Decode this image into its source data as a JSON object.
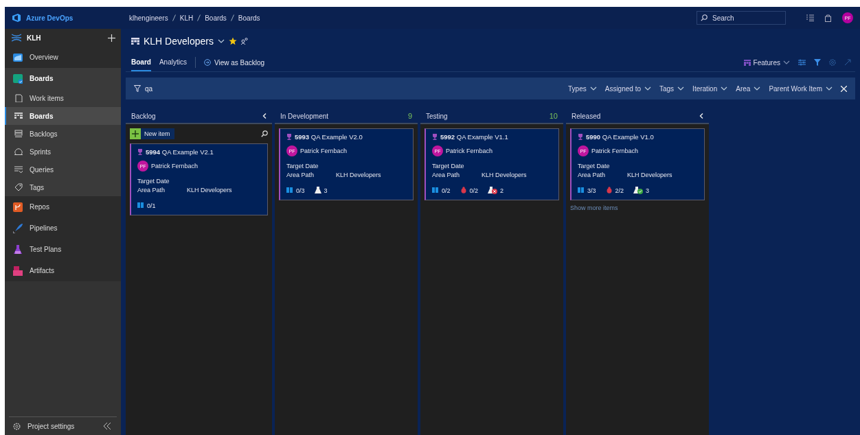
{
  "topbar": {
    "product": "Azure DevOps",
    "breadcrumb": [
      "klhengineers",
      "KLH",
      "Boards",
      "Boards"
    ],
    "search": {
      "placeholder": "Search"
    },
    "avatar": "PF"
  },
  "sidebar": {
    "project": "KLH",
    "items": [
      {
        "label": "Overview",
        "selected": false
      },
      {
        "label": "Boards",
        "selected": false,
        "expanded": true,
        "children": [
          {
            "label": "Work items",
            "selected": false
          },
          {
            "label": "Boards",
            "selected": true
          },
          {
            "label": "Backlogs",
            "selected": false
          },
          {
            "label": "Sprints",
            "selected": false
          },
          {
            "label": "Queries",
            "selected": false
          },
          {
            "label": "Tags",
            "selected": false
          }
        ]
      },
      {
        "label": "Repos",
        "selected": false
      },
      {
        "label": "Pipelines",
        "selected": false
      },
      {
        "label": "Test Plans",
        "selected": false
      },
      {
        "label": "Artifacts",
        "selected": false
      }
    ],
    "footer": "Project settings"
  },
  "header": {
    "team": "KLH Developers",
    "favorite": true,
    "tabs": [
      {
        "label": "Board",
        "selected": true
      },
      {
        "label": "Analytics",
        "selected": false
      }
    ],
    "view_link": "View as Backlog",
    "level_picker": "Features",
    "filter": {
      "keyword": "qa",
      "chips": [
        "Types",
        "Assigned to",
        "Tags",
        "Iteration",
        "Area",
        "Parent Work Item"
      ]
    }
  },
  "columns": [
    {
      "title": "Backlog",
      "collapse_button": true,
      "new_item": "New item",
      "cards": [
        {
          "id": "5994",
          "title": "QA Example V2.1",
          "assignee": "Patrick Fernbach",
          "initials": "PF",
          "fields": [
            {
              "label": "Target Date"
            },
            {
              "label": "Area Path",
              "value": "KLH Developers"
            }
          ],
          "badges": [
            {
              "kind": "stories",
              "text": "0/1"
            }
          ]
        }
      ]
    },
    {
      "title": "In Development",
      "count": "9",
      "cards": [
        {
          "id": "5993",
          "title": "QA Example V2.0",
          "assignee": "Patrick Fernbach",
          "initials": "PF",
          "fields": [
            {
              "label": "Target Date"
            },
            {
              "label": "Area Path",
              "value": "KLH Developers"
            }
          ],
          "badges": [
            {
              "kind": "stories",
              "text": "0/3"
            },
            {
              "kind": "tests",
              "text": "3"
            }
          ]
        }
      ]
    },
    {
      "title": "Testing",
      "count": "10",
      "cards": [
        {
          "id": "5992",
          "title": "QA Example V1.1",
          "assignee": "Patrick Fernbach",
          "initials": "PF",
          "fields": [
            {
              "label": "Target Date"
            },
            {
              "label": "Area Path",
              "value": "KLH Developers"
            }
          ],
          "badges": [
            {
              "kind": "stories",
              "text": "0/2"
            },
            {
              "kind": "bugs",
              "text": "0/2"
            },
            {
              "kind": "tests-failed",
              "text": "2"
            }
          ]
        }
      ]
    },
    {
      "title": "Released",
      "collapse_button": true,
      "more_link": "Show more items",
      "cards": [
        {
          "id": "5990",
          "title": "QA Example V1.0",
          "assignee": "Patrick Fernbach",
          "initials": "PF",
          "fields": [
            {
              "label": "Target Date"
            },
            {
              "label": "Area Path",
              "value": "KLH Developers"
            }
          ],
          "badges": [
            {
              "kind": "stories",
              "text": "3/3"
            },
            {
              "kind": "bugs",
              "text": "2/2"
            },
            {
              "kind": "tests-passed",
              "text": "3"
            }
          ]
        }
      ]
    }
  ]
}
